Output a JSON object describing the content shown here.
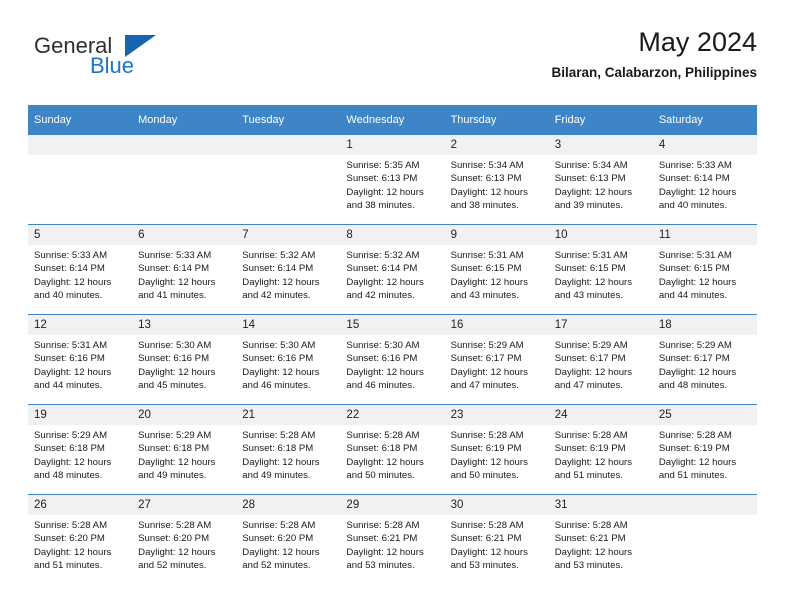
{
  "brand": {
    "name_top": "General",
    "name_bottom": "Blue",
    "accent_color": "#1c76c7",
    "triangle_color": "#1565b0"
  },
  "header": {
    "title": "May 2024",
    "subtitle": "Bilaran, Calabarzon, Philippines"
  },
  "calendar": {
    "header_background": "#3d85c6",
    "header_text_color": "#ffffff",
    "daynum_background": "#f1f1f1",
    "weekdays": [
      "Sunday",
      "Monday",
      "Tuesday",
      "Wednesday",
      "Thursday",
      "Friday",
      "Saturday"
    ],
    "weeks": [
      [
        {
          "day": "",
          "sunrise": "",
          "sunset": "",
          "daylight_a": "",
          "daylight_b": "",
          "empty": true
        },
        {
          "day": "",
          "sunrise": "",
          "sunset": "",
          "daylight_a": "",
          "daylight_b": "",
          "empty": true
        },
        {
          "day": "",
          "sunrise": "",
          "sunset": "",
          "daylight_a": "",
          "daylight_b": "",
          "empty": true
        },
        {
          "day": "1",
          "sunrise": "Sunrise: 5:35 AM",
          "sunset": "Sunset: 6:13 PM",
          "daylight_a": "Daylight: 12 hours",
          "daylight_b": "and 38 minutes."
        },
        {
          "day": "2",
          "sunrise": "Sunrise: 5:34 AM",
          "sunset": "Sunset: 6:13 PM",
          "daylight_a": "Daylight: 12 hours",
          "daylight_b": "and 38 minutes."
        },
        {
          "day": "3",
          "sunrise": "Sunrise: 5:34 AM",
          "sunset": "Sunset: 6:13 PM",
          "daylight_a": "Daylight: 12 hours",
          "daylight_b": "and 39 minutes."
        },
        {
          "day": "4",
          "sunrise": "Sunrise: 5:33 AM",
          "sunset": "Sunset: 6:14 PM",
          "daylight_a": "Daylight: 12 hours",
          "daylight_b": "and 40 minutes."
        }
      ],
      [
        {
          "day": "5",
          "sunrise": "Sunrise: 5:33 AM",
          "sunset": "Sunset: 6:14 PM",
          "daylight_a": "Daylight: 12 hours",
          "daylight_b": "and 40 minutes."
        },
        {
          "day": "6",
          "sunrise": "Sunrise: 5:33 AM",
          "sunset": "Sunset: 6:14 PM",
          "daylight_a": "Daylight: 12 hours",
          "daylight_b": "and 41 minutes."
        },
        {
          "day": "7",
          "sunrise": "Sunrise: 5:32 AM",
          "sunset": "Sunset: 6:14 PM",
          "daylight_a": "Daylight: 12 hours",
          "daylight_b": "and 42 minutes."
        },
        {
          "day": "8",
          "sunrise": "Sunrise: 5:32 AM",
          "sunset": "Sunset: 6:14 PM",
          "daylight_a": "Daylight: 12 hours",
          "daylight_b": "and 42 minutes."
        },
        {
          "day": "9",
          "sunrise": "Sunrise: 5:31 AM",
          "sunset": "Sunset: 6:15 PM",
          "daylight_a": "Daylight: 12 hours",
          "daylight_b": "and 43 minutes."
        },
        {
          "day": "10",
          "sunrise": "Sunrise: 5:31 AM",
          "sunset": "Sunset: 6:15 PM",
          "daylight_a": "Daylight: 12 hours",
          "daylight_b": "and 43 minutes."
        },
        {
          "day": "11",
          "sunrise": "Sunrise: 5:31 AM",
          "sunset": "Sunset: 6:15 PM",
          "daylight_a": "Daylight: 12 hours",
          "daylight_b": "and 44 minutes."
        }
      ],
      [
        {
          "day": "12",
          "sunrise": "Sunrise: 5:31 AM",
          "sunset": "Sunset: 6:16 PM",
          "daylight_a": "Daylight: 12 hours",
          "daylight_b": "and 44 minutes."
        },
        {
          "day": "13",
          "sunrise": "Sunrise: 5:30 AM",
          "sunset": "Sunset: 6:16 PM",
          "daylight_a": "Daylight: 12 hours",
          "daylight_b": "and 45 minutes."
        },
        {
          "day": "14",
          "sunrise": "Sunrise: 5:30 AM",
          "sunset": "Sunset: 6:16 PM",
          "daylight_a": "Daylight: 12 hours",
          "daylight_b": "and 46 minutes."
        },
        {
          "day": "15",
          "sunrise": "Sunrise: 5:30 AM",
          "sunset": "Sunset: 6:16 PM",
          "daylight_a": "Daylight: 12 hours",
          "daylight_b": "and 46 minutes."
        },
        {
          "day": "16",
          "sunrise": "Sunrise: 5:29 AM",
          "sunset": "Sunset: 6:17 PM",
          "daylight_a": "Daylight: 12 hours",
          "daylight_b": "and 47 minutes."
        },
        {
          "day": "17",
          "sunrise": "Sunrise: 5:29 AM",
          "sunset": "Sunset: 6:17 PM",
          "daylight_a": "Daylight: 12 hours",
          "daylight_b": "and 47 minutes."
        },
        {
          "day": "18",
          "sunrise": "Sunrise: 5:29 AM",
          "sunset": "Sunset: 6:17 PM",
          "daylight_a": "Daylight: 12 hours",
          "daylight_b": "and 48 minutes."
        }
      ],
      [
        {
          "day": "19",
          "sunrise": "Sunrise: 5:29 AM",
          "sunset": "Sunset: 6:18 PM",
          "daylight_a": "Daylight: 12 hours",
          "daylight_b": "and 48 minutes."
        },
        {
          "day": "20",
          "sunrise": "Sunrise: 5:29 AM",
          "sunset": "Sunset: 6:18 PM",
          "daylight_a": "Daylight: 12 hours",
          "daylight_b": "and 49 minutes."
        },
        {
          "day": "21",
          "sunrise": "Sunrise: 5:28 AM",
          "sunset": "Sunset: 6:18 PM",
          "daylight_a": "Daylight: 12 hours",
          "daylight_b": "and 49 minutes."
        },
        {
          "day": "22",
          "sunrise": "Sunrise: 5:28 AM",
          "sunset": "Sunset: 6:18 PM",
          "daylight_a": "Daylight: 12 hours",
          "daylight_b": "and 50 minutes."
        },
        {
          "day": "23",
          "sunrise": "Sunrise: 5:28 AM",
          "sunset": "Sunset: 6:19 PM",
          "daylight_a": "Daylight: 12 hours",
          "daylight_b": "and 50 minutes."
        },
        {
          "day": "24",
          "sunrise": "Sunrise: 5:28 AM",
          "sunset": "Sunset: 6:19 PM",
          "daylight_a": "Daylight: 12 hours",
          "daylight_b": "and 51 minutes."
        },
        {
          "day": "25",
          "sunrise": "Sunrise: 5:28 AM",
          "sunset": "Sunset: 6:19 PM",
          "daylight_a": "Daylight: 12 hours",
          "daylight_b": "and 51 minutes."
        }
      ],
      [
        {
          "day": "26",
          "sunrise": "Sunrise: 5:28 AM",
          "sunset": "Sunset: 6:20 PM",
          "daylight_a": "Daylight: 12 hours",
          "daylight_b": "and 51 minutes."
        },
        {
          "day": "27",
          "sunrise": "Sunrise: 5:28 AM",
          "sunset": "Sunset: 6:20 PM",
          "daylight_a": "Daylight: 12 hours",
          "daylight_b": "and 52 minutes."
        },
        {
          "day": "28",
          "sunrise": "Sunrise: 5:28 AM",
          "sunset": "Sunset: 6:20 PM",
          "daylight_a": "Daylight: 12 hours",
          "daylight_b": "and 52 minutes."
        },
        {
          "day": "29",
          "sunrise": "Sunrise: 5:28 AM",
          "sunset": "Sunset: 6:21 PM",
          "daylight_a": "Daylight: 12 hours",
          "daylight_b": "and 53 minutes."
        },
        {
          "day": "30",
          "sunrise": "Sunrise: 5:28 AM",
          "sunset": "Sunset: 6:21 PM",
          "daylight_a": "Daylight: 12 hours",
          "daylight_b": "and 53 minutes."
        },
        {
          "day": "31",
          "sunrise": "Sunrise: 5:28 AM",
          "sunset": "Sunset: 6:21 PM",
          "daylight_a": "Daylight: 12 hours",
          "daylight_b": "and 53 minutes."
        },
        {
          "day": "",
          "sunrise": "",
          "sunset": "",
          "daylight_a": "",
          "daylight_b": "",
          "empty": true
        }
      ]
    ]
  }
}
